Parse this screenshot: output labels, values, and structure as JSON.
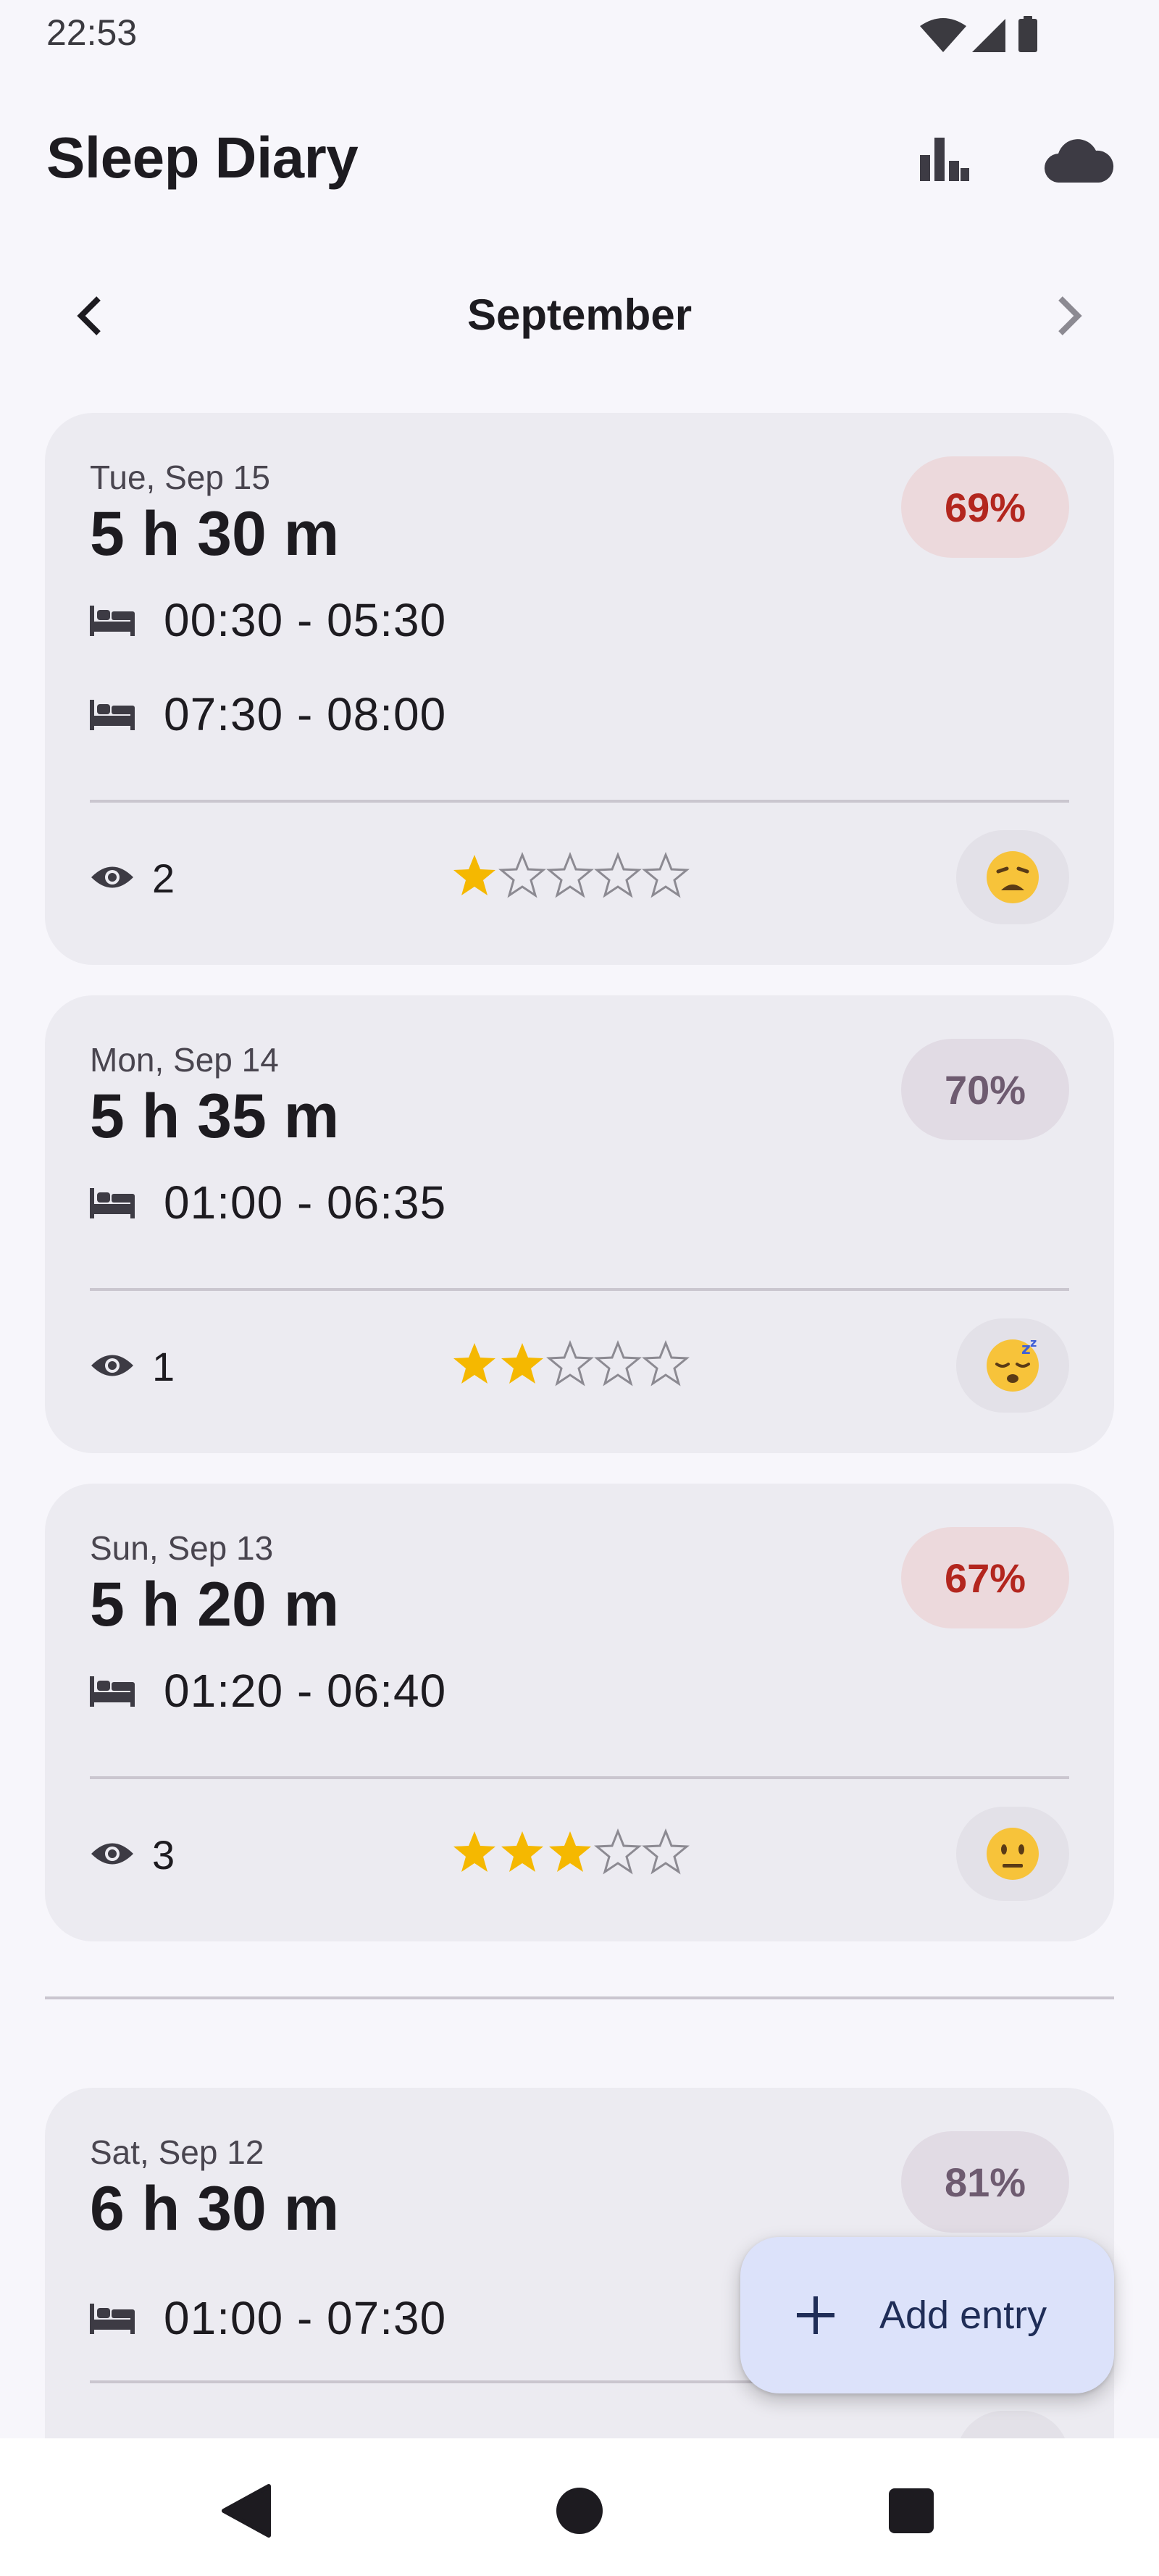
{
  "status_bar": {
    "time": "22:53"
  },
  "app": {
    "title": "Sleep Diary"
  },
  "toolbar": {
    "stats_icon": "bar-chart-icon",
    "backup_icon": "cloud-icon"
  },
  "month_nav": {
    "label": "September"
  },
  "entries": [
    {
      "date": "Tue, Sep 15",
      "duration": "5 h 30 m",
      "score": "69%",
      "score_level": "low",
      "intervals": [
        "00:30 - 05:30",
        "07:30 - 08:00"
      ],
      "awakenings": "2",
      "rating": 1,
      "mood": "weary-face"
    },
    {
      "date": "Mon, Sep 14",
      "duration": "5 h 35 m",
      "score": "70%",
      "score_level": "mid",
      "intervals": [
        "01:00 - 06:35"
      ],
      "awakenings": "1",
      "rating": 2,
      "mood": "sleeping-face"
    },
    {
      "date": "Sun, Sep 13",
      "duration": "5 h 20 m",
      "score": "67%",
      "score_level": "low",
      "intervals": [
        "01:20 - 06:40"
      ],
      "awakenings": "3",
      "rating": 3,
      "mood": "neutral-face"
    },
    {
      "date": "Sat, Sep 12",
      "duration": "6 h 30 m",
      "score": "81%",
      "score_level": "mid",
      "intervals": [
        "01:00 - 07:30"
      ]
    }
  ],
  "fab": {
    "label": "Add entry"
  },
  "colors": {
    "background": "#f7f6fb",
    "card": "#ecebf1",
    "score_low_text": "#b3261e",
    "score_mid_text": "#6e5b70",
    "star": "#f5b800",
    "fab": "#dce2fa"
  }
}
